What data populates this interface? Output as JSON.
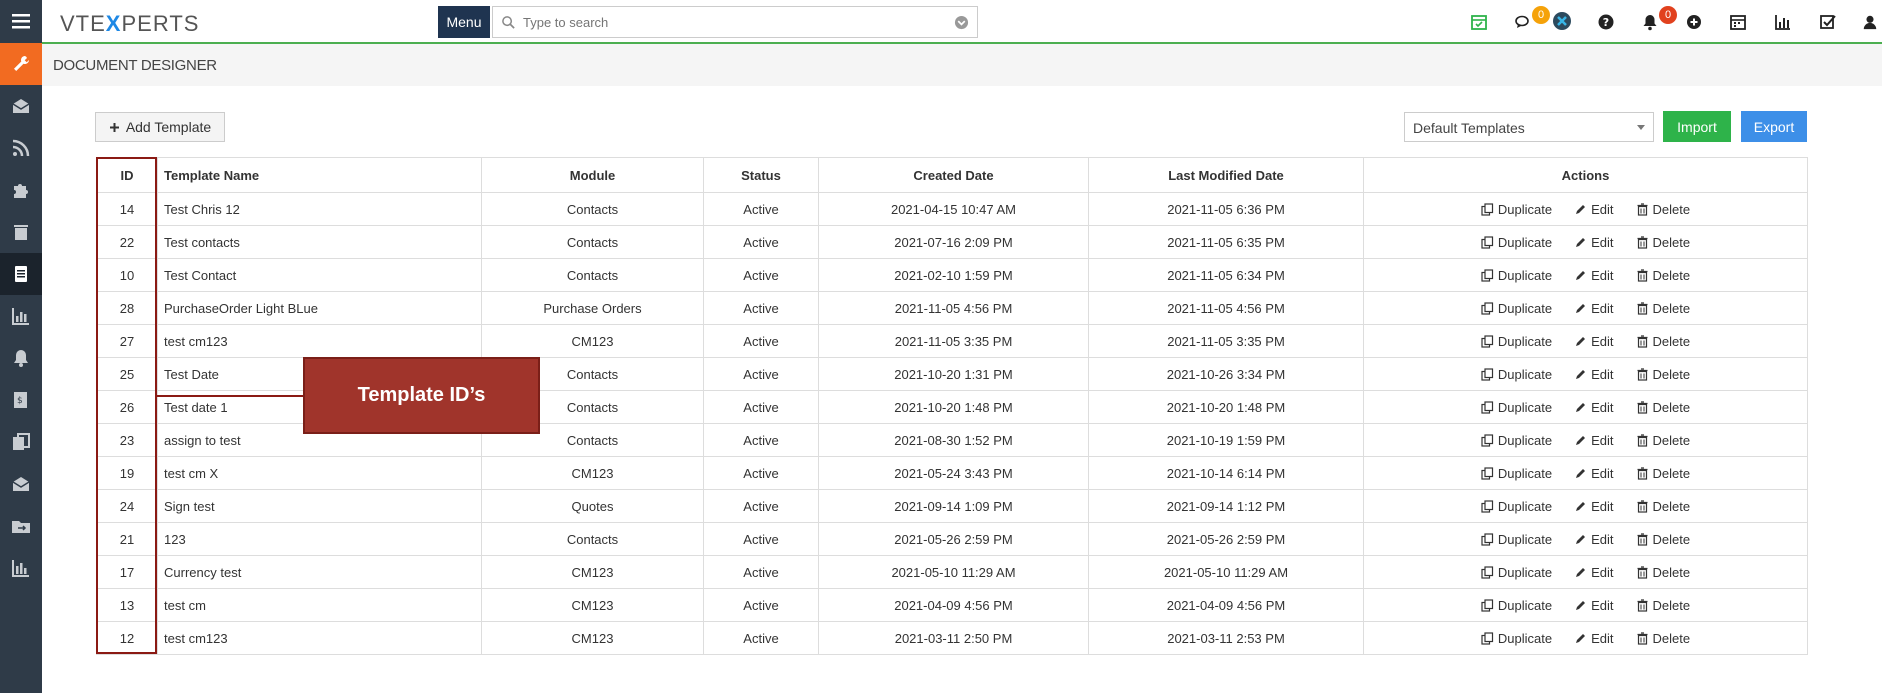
{
  "app": {
    "logo_prefix": "VTE",
    "logo_x": "X",
    "logo_suffix": "PERTS"
  },
  "topbar": {
    "menu_label": "Menu",
    "search_placeholder": "Type to search",
    "chat_badge": "0",
    "notif_badge": "0"
  },
  "page": {
    "title": "DOCUMENT DESIGNER"
  },
  "toolbar": {
    "add_label": "Add Template",
    "select_value": "Default Templates",
    "import_label": "Import",
    "export_label": "Export"
  },
  "table": {
    "headers": [
      "ID",
      "Template Name",
      "Module",
      "Status",
      "Created Date",
      "Last Modified Date",
      "Actions"
    ],
    "action_labels": [
      "Duplicate",
      "Edit",
      "Delete"
    ],
    "rows": [
      {
        "id": "14",
        "name": "Test Chris 12",
        "module": "Contacts",
        "status": "Active",
        "created": "2021-04-15 10:47 AM",
        "modified": "2021-11-05 6:36 PM"
      },
      {
        "id": "22",
        "name": "Test contacts",
        "module": "Contacts",
        "status": "Active",
        "created": "2021-07-16 2:09 PM",
        "modified": "2021-11-05 6:35 PM"
      },
      {
        "id": "10",
        "name": "Test Contact",
        "module": "Contacts",
        "status": "Active",
        "created": "2021-02-10 1:59 PM",
        "modified": "2021-11-05 6:34 PM"
      },
      {
        "id": "28",
        "name": "PurchaseOrder Light BLue",
        "module": "Purchase Orders",
        "status": "Active",
        "created": "2021-11-05 4:56 PM",
        "modified": "2021-11-05 4:56 PM"
      },
      {
        "id": "27",
        "name": "test cm123",
        "module": "CM123",
        "status": "Active",
        "created": "2021-11-05 3:35 PM",
        "modified": "2021-11-05 3:35 PM"
      },
      {
        "id": "25",
        "name": "Test Date",
        "module": "Contacts",
        "status": "Active",
        "created": "2021-10-20 1:31 PM",
        "modified": "2021-10-26 3:34 PM"
      },
      {
        "id": "26",
        "name": "Test date 1",
        "module": "Contacts",
        "status": "Active",
        "created": "2021-10-20 1:48 PM",
        "modified": "2021-10-20 1:48 PM"
      },
      {
        "id": "23",
        "name": "assign to test",
        "module": "Contacts",
        "status": "Active",
        "created": "2021-08-30 1:52 PM",
        "modified": "2021-10-19 1:59 PM"
      },
      {
        "id": "19",
        "name": "test cm X",
        "module": "CM123",
        "status": "Active",
        "created": "2021-05-24 3:43 PM",
        "modified": "2021-10-14 6:14 PM"
      },
      {
        "id": "24",
        "name": "Sign test",
        "module": "Quotes",
        "status": "Active",
        "created": "2021-09-14 1:09 PM",
        "modified": "2021-09-14 1:12 PM"
      },
      {
        "id": "21",
        "name": "123",
        "module": "Contacts",
        "status": "Active",
        "created": "2021-05-26 2:59 PM",
        "modified": "2021-05-26 2:59 PM"
      },
      {
        "id": "17",
        "name": "Currency test",
        "module": "CM123",
        "status": "Active",
        "created": "2021-05-10 11:29 AM",
        "modified": "2021-05-10 11:29 AM"
      },
      {
        "id": "13",
        "name": "test cm",
        "module": "CM123",
        "status": "Active",
        "created": "2021-04-09 4:56 PM",
        "modified": "2021-04-09 4:56 PM"
      },
      {
        "id": "12",
        "name": "test cm123",
        "module": "CM123",
        "status": "Active",
        "created": "2021-03-11 2:50 PM",
        "modified": "2021-03-11 2:53 PM"
      }
    ]
  },
  "annotation": {
    "callout_text": "Template ID’s"
  },
  "colors": {
    "sidebar": "#2f3b48",
    "accent_orange": "#f26b21",
    "import_green": "#2eb34a",
    "export_blue": "#3d8fe8",
    "callout": "#a0342b"
  }
}
